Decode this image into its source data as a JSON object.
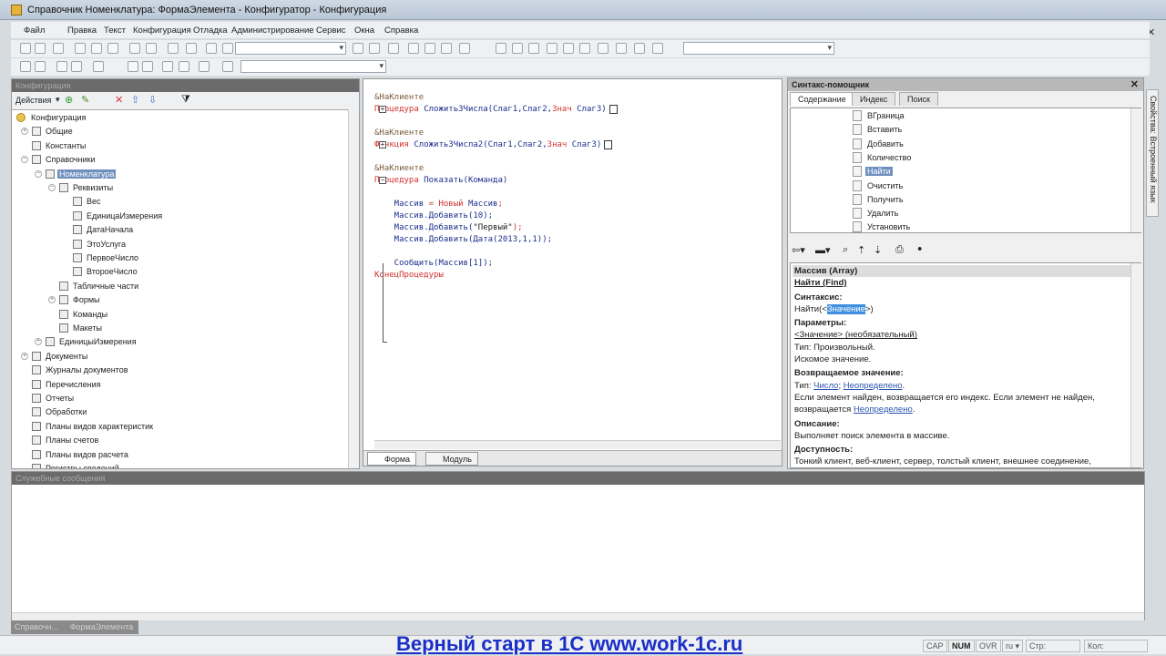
{
  "window": {
    "title": "Справочник Номенклатура: ФормаЭлемента - Конфигуратор - Конфигурация"
  },
  "menu": [
    "Файл",
    "Правка",
    "Текст",
    "Конфигурация",
    "Отладка",
    "Администрирование",
    "Сервис",
    "Окна",
    "Справка"
  ],
  "config_panel": {
    "title": "Конфигурация",
    "actions_label": "Действия",
    "tree": [
      {
        "label": "Конфигурация",
        "level": 0,
        "exp": ""
      },
      {
        "label": "Общие",
        "level": 1,
        "exp": "+"
      },
      {
        "label": "Константы",
        "level": 1,
        "exp": ""
      },
      {
        "label": "Справочники",
        "level": 1,
        "exp": "-"
      },
      {
        "label": "Номенклатура",
        "level": 2,
        "exp": "-",
        "selected": true
      },
      {
        "label": "Реквизиты",
        "level": 3,
        "exp": "-"
      },
      {
        "label": "Вес",
        "level": 4,
        "exp": ""
      },
      {
        "label": "ЕдиницаИзмерения",
        "level": 4,
        "exp": ""
      },
      {
        "label": "ДатаНачала",
        "level": 4,
        "exp": ""
      },
      {
        "label": "ЭтоУслуга",
        "level": 4,
        "exp": ""
      },
      {
        "label": "ПервоеЧисло",
        "level": 4,
        "exp": ""
      },
      {
        "label": "ВтороеЧисло",
        "level": 4,
        "exp": ""
      },
      {
        "label": "Табличные части",
        "level": 3,
        "exp": ""
      },
      {
        "label": "Формы",
        "level": 3,
        "exp": "+"
      },
      {
        "label": "Команды",
        "level": 3,
        "exp": ""
      },
      {
        "label": "Макеты",
        "level": 3,
        "exp": ""
      },
      {
        "label": "ЕдиницыИзмерения",
        "level": 2,
        "exp": "+"
      },
      {
        "label": "Документы",
        "level": 1,
        "exp": "+"
      },
      {
        "label": "Журналы документов",
        "level": 1,
        "exp": ""
      },
      {
        "label": "Перечисления",
        "level": 1,
        "exp": ""
      },
      {
        "label": "Отчеты",
        "level": 1,
        "exp": ""
      },
      {
        "label": "Обработки",
        "level": 1,
        "exp": ""
      },
      {
        "label": "Планы видов характеристик",
        "level": 1,
        "exp": ""
      },
      {
        "label": "Планы счетов",
        "level": 1,
        "exp": ""
      },
      {
        "label": "Планы видов расчета",
        "level": 1,
        "exp": ""
      },
      {
        "label": "Регистры сведений",
        "level": 1,
        "exp": ""
      }
    ]
  },
  "editor": {
    "lines": [
      [
        [
          "dr",
          "&НаКлиенте"
        ]
      ],
      [
        [
          "kw",
          "Процедура "
        ],
        [
          "id",
          "Сложить3Числа(Слаг1,Слаг2,"
        ],
        [
          "kw",
          "Знач "
        ],
        [
          "id",
          "Слаг3)"
        ]
      ],
      [],
      [
        [
          "dr",
          "&НаКлиенте"
        ]
      ],
      [
        [
          "kw",
          "Функция "
        ],
        [
          "id",
          "Сложить3Числа2(Слаг1,Слаг2,"
        ],
        [
          "kw",
          "Знач "
        ],
        [
          "id",
          "Слаг3)"
        ]
      ],
      [],
      [
        [
          "dr",
          "&НаКлиенте"
        ]
      ],
      [
        [
          "kw",
          "Процедура "
        ],
        [
          "id",
          "Показать(Команда)"
        ]
      ],
      [],
      [
        [
          "id",
          "    Массив "
        ],
        [
          "op",
          "= "
        ],
        [
          "kw",
          "Новый "
        ],
        [
          "id",
          "Массив"
        ],
        [
          "op",
          ";"
        ]
      ],
      [
        [
          "id",
          "    Массив.Добавить(10);"
        ]
      ],
      [
        [
          "id",
          "    Массив.Добавить("
        ],
        [
          "st",
          "\"Первый\""
        ],
        [
          "op",
          ");"
        ]
      ],
      [
        [
          "id",
          "    Массив.Добавить(Дата(2013,1,1));"
        ]
      ],
      [],
      [
        [
          "id",
          "    Сообщить(Массив[1]);"
        ]
      ],
      [
        [
          "kw",
          "КонецПроцедуры"
        ]
      ]
    ],
    "tabs": [
      "Форма",
      "Модуль"
    ]
  },
  "helper": {
    "title": "Синтакс-помощник",
    "tabs": [
      "Содержание",
      "Индекс",
      "Поиск"
    ],
    "items": [
      "ВГраница",
      "Вставить",
      "Добавить",
      "Количество",
      "Найти",
      "Очистить",
      "Получить",
      "Удалить",
      "Установить"
    ],
    "selected": "Найти",
    "doc": {
      "object": "Массив (Array)",
      "method": "Найти (Find)",
      "syntax_h": "Синтаксис:",
      "syntax_pre": "Найти(<",
      "syntax_param": "Значение",
      "syntax_post": ">)",
      "params_h": "Параметры:",
      "param": "<Значение> (необязательный)",
      "param_type": "Тип: Произвольный.",
      "param_desc": "Искомое значение.",
      "ret_h": "Возвращаемое значение:",
      "ret_pre": "Тип: ",
      "ret_t1": "Число",
      "ret_sep": "; ",
      "ret_t2": "Неопределено",
      "ret_end": ".",
      "ret_desc": "Если элемент найден, возвращается его индекс. Если элемент не найден, возвращается ",
      "ret_link": "Неопределено",
      "ret_desc_end": ".",
      "desc_h": "Описание:",
      "desc": "Выполняет поиск элемента в массиве.",
      "avail_h": "Доступность:",
      "avail": "Тонкий клиент, веб-клиент, сервер, толстый клиент, внешнее соединение,"
    }
  },
  "side_tab": "Свойства: Встроенный язык",
  "messages": {
    "title": "Служебные сообщения"
  },
  "taskbar": {
    "items": [
      "Справочн...",
      "ФормаЭлемента"
    ]
  },
  "status": {
    "cap": "CAP",
    "num": "NUM",
    "ovr": "OVR",
    "lang": "ru ▾",
    "row": "Стр:",
    "col": "Кол:"
  },
  "watermark": "Верный старт в 1С www.work-1c.ru"
}
